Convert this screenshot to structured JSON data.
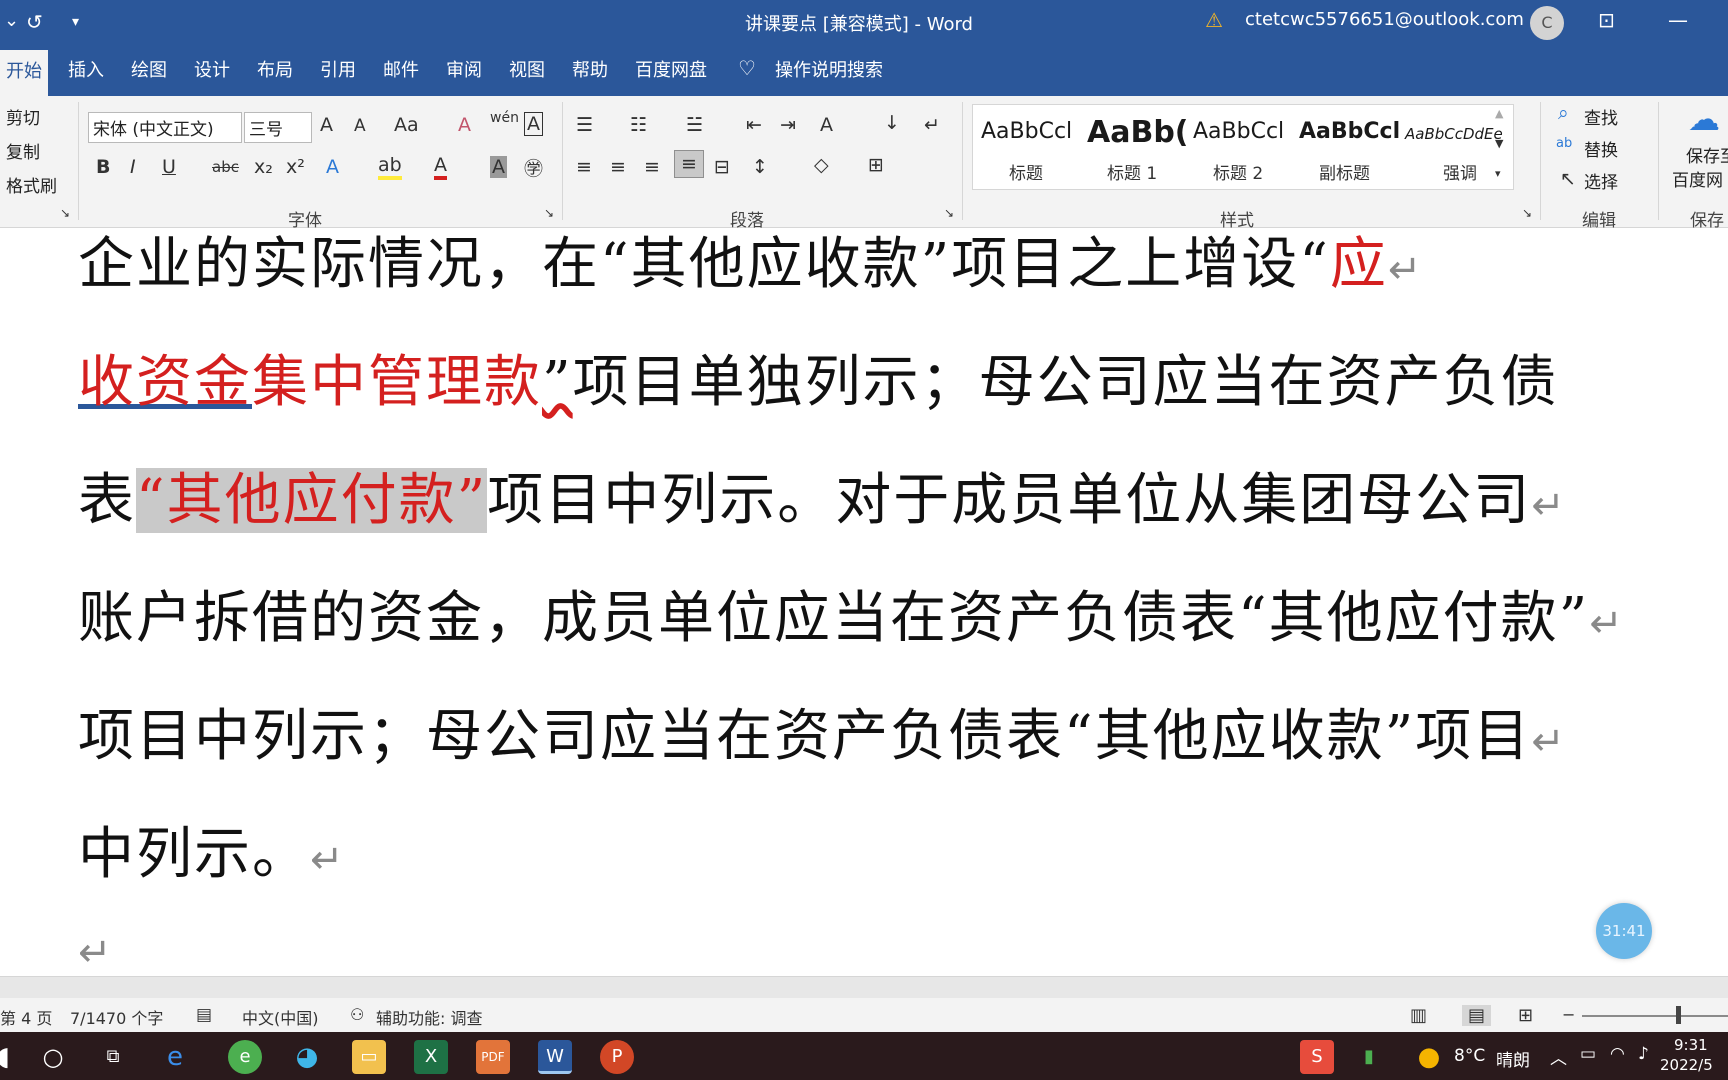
{
  "window": {
    "title": "讲课要点 [兼容模式]  -  Word",
    "account_email": "ctetcwc5576651@outlook.com",
    "avatar_initial": "C"
  },
  "tabs": [
    "开始",
    "插入",
    "绘图",
    "设计",
    "布局",
    "引用",
    "邮件",
    "审阅",
    "视图",
    "帮助",
    "百度网盘"
  ],
  "tell_me": "操作说明搜索",
  "ribbon": {
    "clipboard": {
      "cut": "剪切",
      "copy": "复制",
      "format_painter": "格式刷"
    },
    "font": {
      "font_name": "宋体 (中文正文)",
      "font_size": "三号",
      "group_label": "字体"
    },
    "paragraph": {
      "group_label": "段落"
    },
    "styles": {
      "group_label": "样式",
      "items": [
        {
          "sample": "AaBbCcl",
          "name": "标题"
        },
        {
          "sample": "AaBb(",
          "name": "标题 1"
        },
        {
          "sample": "AaBbCcl",
          "name": "标题 2"
        },
        {
          "sample": "AaBbCcl",
          "name": "副标题"
        },
        {
          "sample": "AaBbCcDdEe",
          "name": "强调"
        }
      ]
    },
    "editing": {
      "find": "查找",
      "replace": "替换",
      "select": "选择",
      "group_label": "编辑"
    },
    "save": {
      "line1": "保存至",
      "line2": "百度网",
      "group_label": "保存"
    }
  },
  "document": {
    "line1_a": "企业的实际情况，在“其他应收款”项目之上增设“",
    "line1_red": "应",
    "line2_red_a": "收资金",
    "line2_red_b": "集中管理款",
    "line2_b": "”",
    "line2_c": "项目单独列示；母公司应当在资产负债",
    "line3_a": "表",
    "line3_hl": "“其他应付款”",
    "line3_b": "项目中列示。对于成员单位从集团母公司",
    "line4": "账户拆借的资金，成员单位应当在资产负债表“其他应付款”",
    "line5": "项目中列示；母公司应当在资产负债表“其他应收款”项目",
    "line6": "中列示。",
    "para_mark": "↵"
  },
  "timer": "31:41",
  "status": {
    "page": "第 4 页",
    "words": "7/1470 个字",
    "language": "中文(中国)",
    "accessibility": "辅助功能: 调查"
  },
  "taskbar": {
    "weather_temp": "8°C",
    "weather_desc": "晴朗",
    "time": "9:31",
    "date": "2022/5"
  }
}
